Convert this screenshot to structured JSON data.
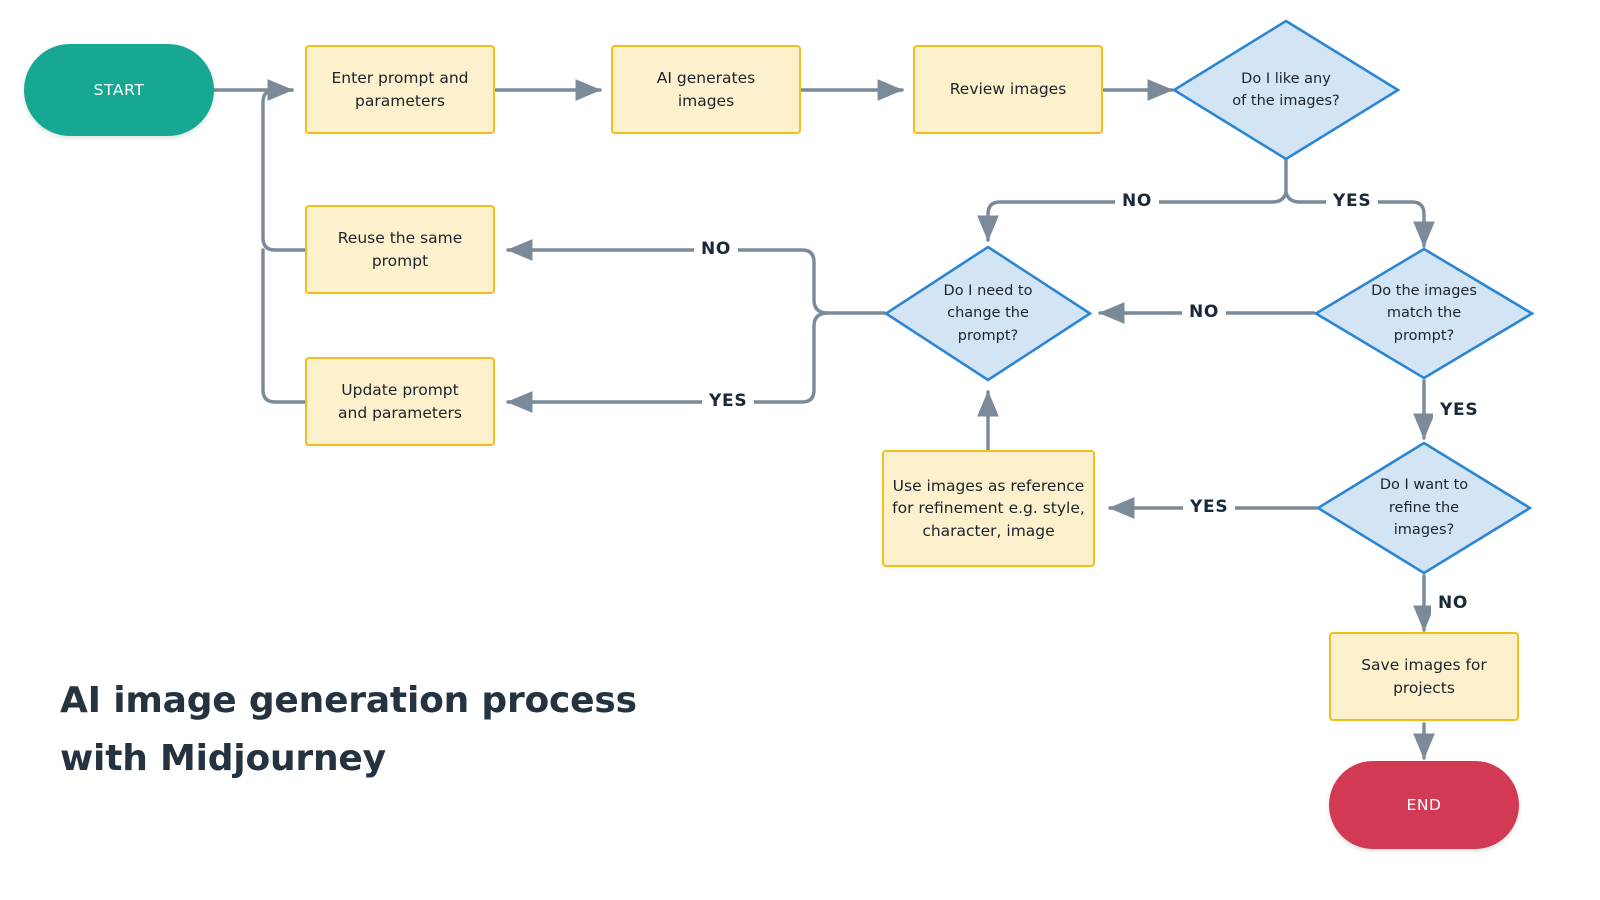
{
  "title": "AI image generation process\nwith Midjourney",
  "colors": {
    "background": "#ffffff",
    "process_fill": "#fdf0cd",
    "process_border": "#f0c01f",
    "decision_fill": "#d3e5f5",
    "decision_border": "#2a86d4",
    "start_fill": "#17a894",
    "end_fill": "#d13a52",
    "connector": "#7b8a99",
    "text": "#1d232b",
    "title_text": "#25323f",
    "label_text": "#1b2838"
  },
  "nodes": {
    "start": {
      "label": "START",
      "type": "terminator"
    },
    "enter_prompt": {
      "label": "Enter prompt and\nparameters",
      "type": "process"
    },
    "ai_generates": {
      "label": "AI generates\nimages",
      "type": "process"
    },
    "review_images": {
      "label": "Review images",
      "type": "process"
    },
    "like_any": {
      "label": "Do I like any\nof the images?",
      "type": "decision"
    },
    "reuse_prompt": {
      "label": "Reuse the same\nprompt",
      "type": "process"
    },
    "update_prompt": {
      "label": "Update prompt\nand parameters",
      "type": "process"
    },
    "need_change": {
      "label": "Do I need to\nchange the\nprompt?",
      "type": "decision"
    },
    "images_match": {
      "label": "Do the images\nmatch the\nprompt?",
      "type": "decision"
    },
    "want_refine": {
      "label": "Do I want to\nrefine the\nimages?",
      "type": "decision"
    },
    "use_reference": {
      "label": "Use images as reference\nfor refinement e.g. style,\ncharacter, image",
      "type": "process"
    },
    "save_images": {
      "label": "Save images for\nprojects",
      "type": "process"
    },
    "end": {
      "label": "END",
      "type": "terminator"
    }
  },
  "edge_labels": {
    "like_any_no": "NO",
    "like_any_yes": "YES",
    "match_no": "NO",
    "match_yes": "YES",
    "refine_yes": "YES",
    "refine_no": "NO",
    "change_no": "NO",
    "change_yes": "YES"
  }
}
